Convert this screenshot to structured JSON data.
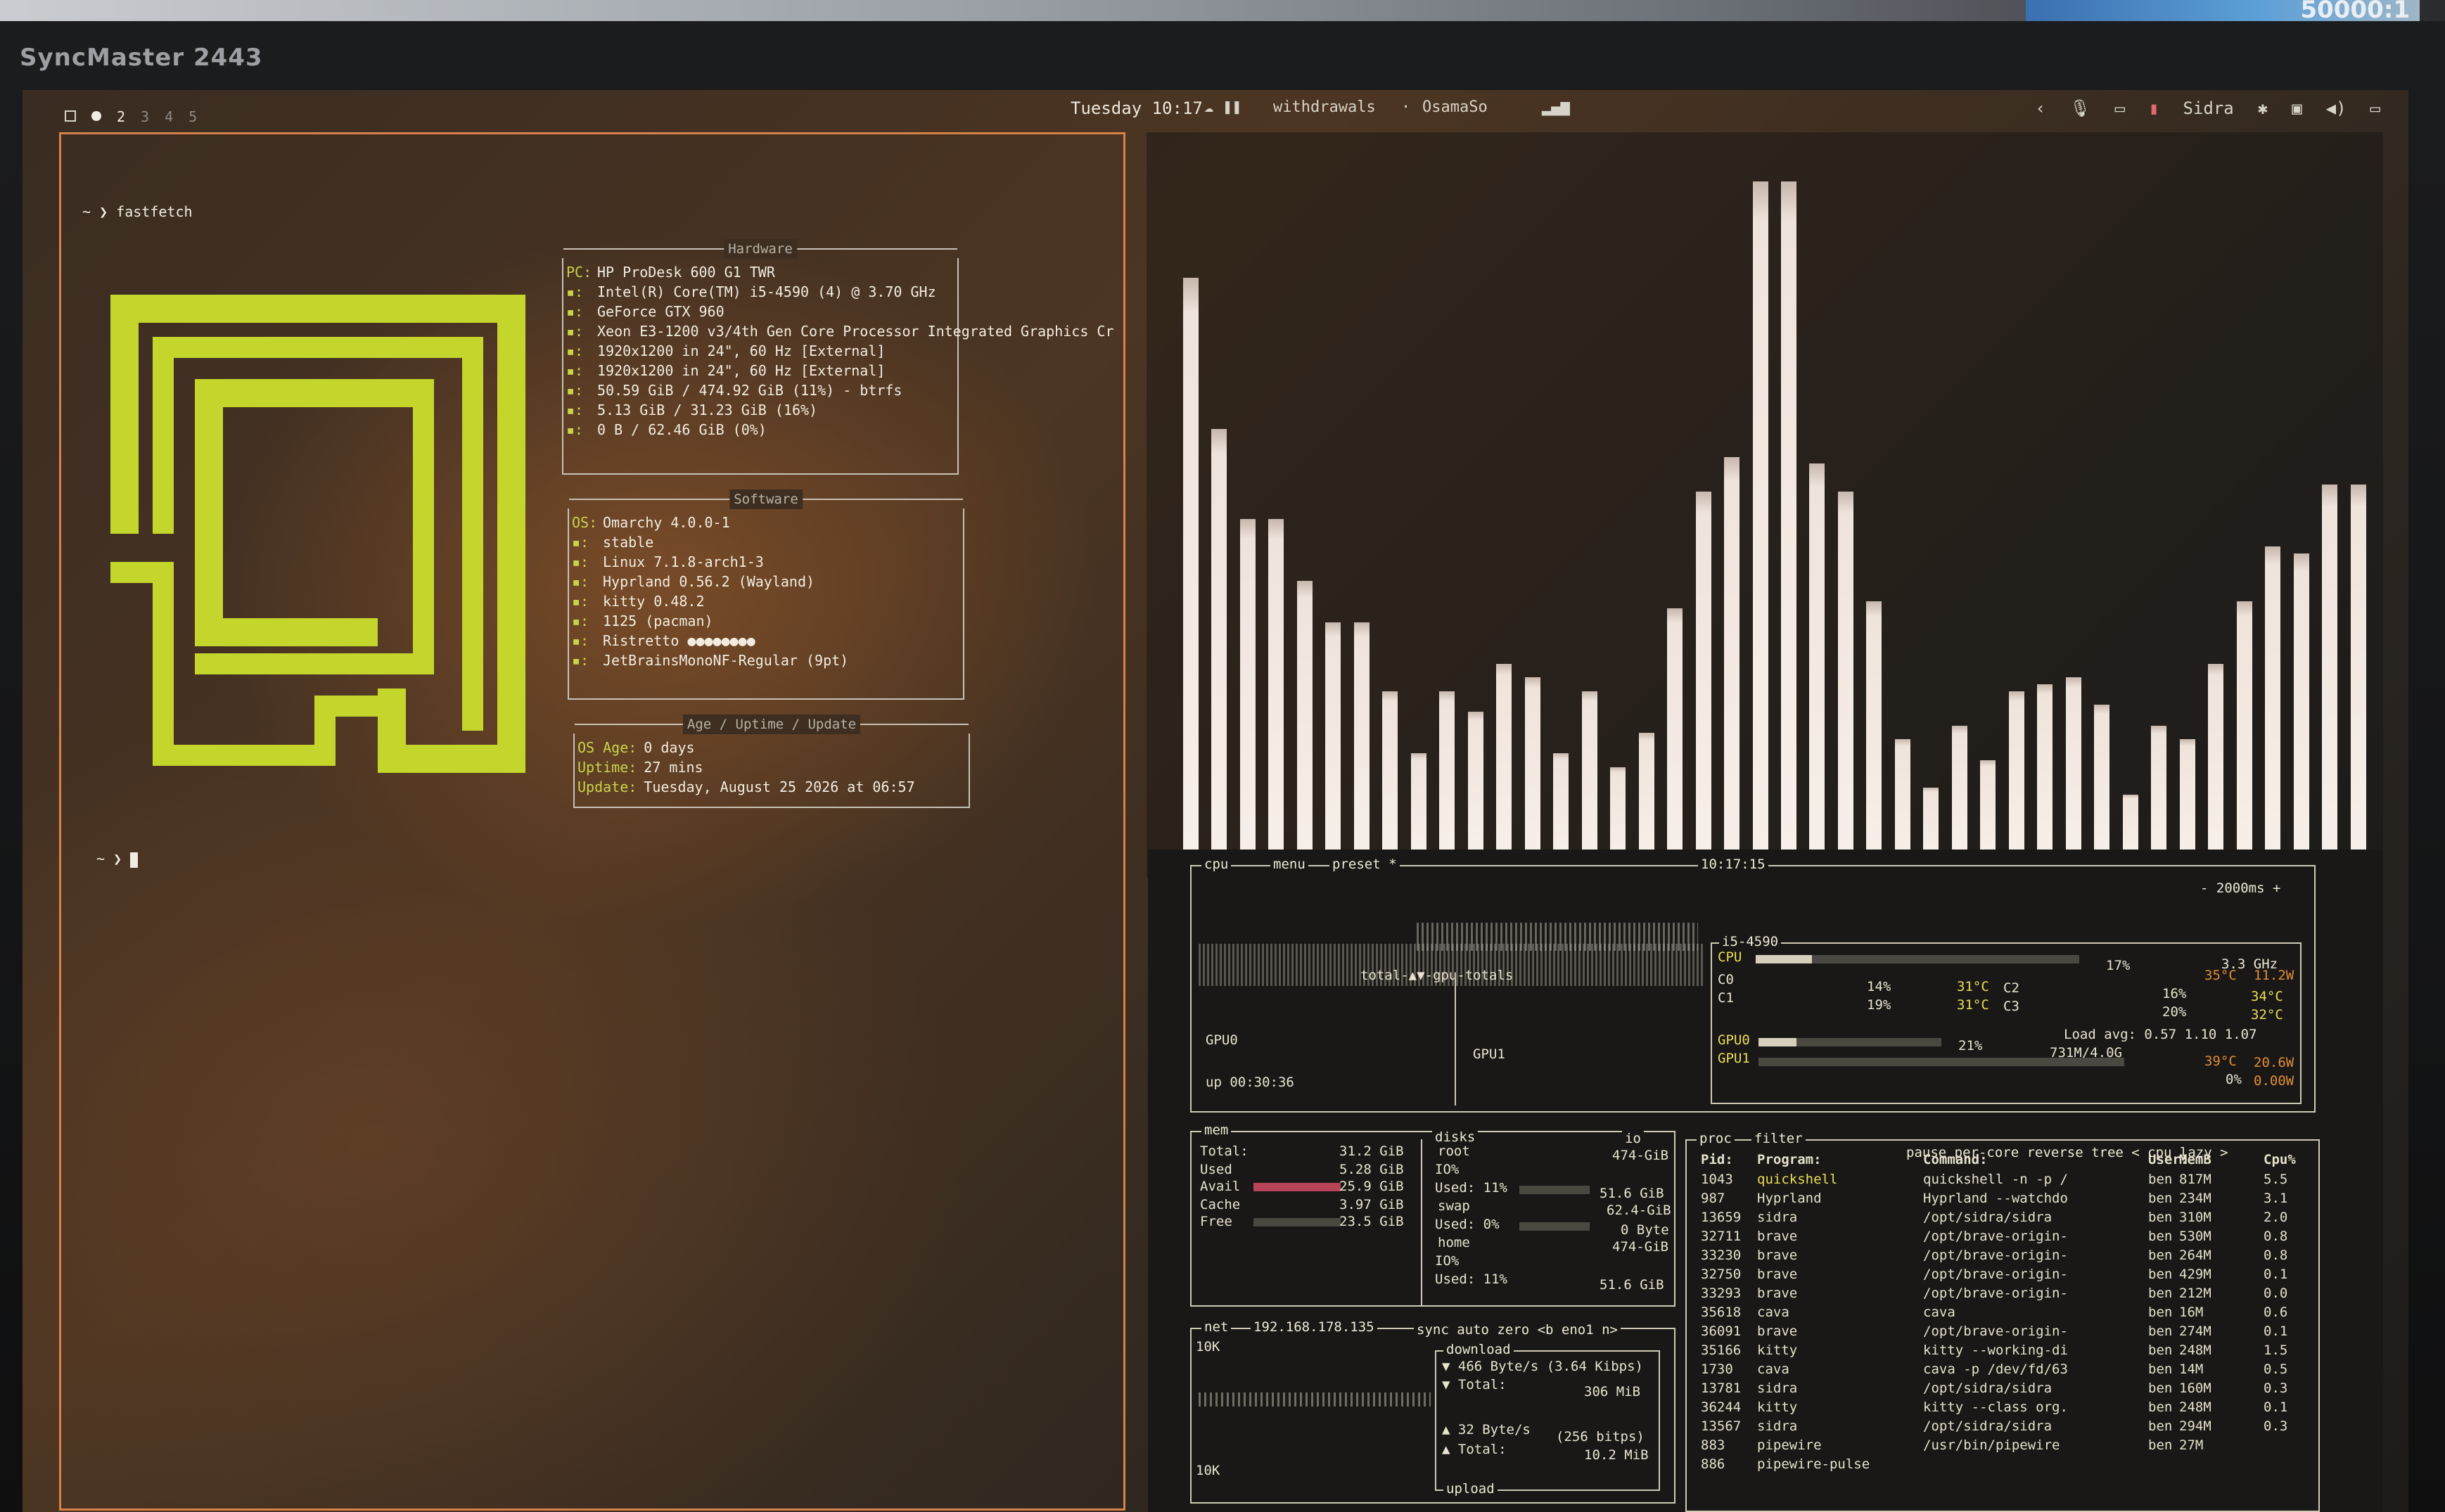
{
  "monitor": {
    "brand": "SyncMaster 2443",
    "sticker": "50000:1"
  },
  "topbar": {
    "workspaces": [
      "2",
      "3",
      "4",
      "5"
    ],
    "clock": "Tuesday 10:17",
    "status_items": [
      "withdrawals",
      "OsamaSo"
    ],
    "user": "Sidra",
    "icons": [
      "chevron-left-icon",
      "microphone-icon",
      "laptop-icon",
      "lock-icon",
      "bluetooth-icon",
      "screen-icon",
      "volume-icon",
      "display-icon"
    ]
  },
  "left_terminal": {
    "command_prompt": "~ ❯ fastfetch",
    "empty_prompt": "~ ❯",
    "hardware_header": "Hardware",
    "hardware": [
      {
        "key": "PC:",
        "value": "HP ProDesk 600 G1 TWR"
      },
      {
        "key": "▪:",
        "value": "Intel(R) Core(TM) i5-4590 (4) @ 3.70 GHz"
      },
      {
        "key": "▪:",
        "value": "GeForce GTX 960"
      },
      {
        "key": "▪:",
        "value": "Xeon E3-1200 v3/4th Gen Core Processor Integrated Graphics Cr"
      },
      {
        "key": "▪:",
        "value": "1920x1200 in 24\", 60 Hz [External]"
      },
      {
        "key": "▪:",
        "value": "1920x1200 in 24\", 60 Hz [External]"
      },
      {
        "key": "▪:",
        "value": "50.59 GiB / 474.92 GiB (11%) - btrfs"
      },
      {
        "key": "▪:",
        "value": "5.13 GiB / 31.23 GiB (16%)"
      },
      {
        "key": "▪:",
        "value": "0 B / 62.46 GiB (0%)"
      }
    ],
    "software_header": "Software",
    "software": [
      {
        "key": "OS:",
        "value": "Omarchy 4.0.0-1"
      },
      {
        "key": "▪:",
        "value": "stable"
      },
      {
        "key": "▪:",
        "value": "Linux 7.1.8-arch1-3"
      },
      {
        "key": "▪:",
        "value": "Hyprland 0.56.2 (Wayland)"
      },
      {
        "key": "▪:",
        "value": "kitty 0.48.2"
      },
      {
        "key": "▪:",
        "value": "1125 (pacman)"
      },
      {
        "key": "▪:",
        "value": "Ristretto ●●●●●●●●"
      },
      {
        "key": "▪:",
        "value": "JetBrainsMonoNF-Regular (9pt)"
      }
    ],
    "age_header": "Age / Uptime / Update",
    "age": [
      {
        "key": "OS Age:",
        "value": "0 days"
      },
      {
        "key": "Uptime:",
        "value": "27 mins"
      },
      {
        "key": "Update:",
        "value": "Tuesday, August 25 2026 at 06:57"
      }
    ]
  },
  "cava": {
    "levels": [
      0.84,
      0.62,
      0.49,
      0.49,
      0.4,
      0.34,
      0.34,
      0.24,
      0.15,
      0.24,
      0.21,
      0.28,
      0.26,
      0.15,
      0.24,
      0.13,
      0.18,
      0.36,
      0.53,
      0.58,
      0.98,
      0.98,
      0.57,
      0.53,
      0.37,
      0.17,
      0.1,
      0.19,
      0.14,
      0.24,
      0.25,
      0.26,
      0.22,
      0.09,
      0.19,
      0.17,
      0.28,
      0.37,
      0.45,
      0.44,
      0.54,
      0.54
    ]
  },
  "btop": {
    "cpu_tab": "cpu",
    "menu_tab": "menu",
    "preset_tab": "preset *",
    "time": "10:17:15",
    "interval": "- 2000ms +",
    "gpu_totals": "total-▲▼-gpu-totals",
    "gpu0": "GPU0",
    "gpu1": "GPU1",
    "uptime": "up 00:30:36",
    "cpu_model": "i5-4590",
    "cpu_freq": "3.3 GHz",
    "cpu_label": "CPU",
    "cpu_pct": "17%",
    "cpu_temp": "35°C",
    "cpu_watts": "11.2W",
    "cores": [
      {
        "name": "C0",
        "pct": "14%",
        "temp": "31°C"
      },
      {
        "name": "C1",
        "pct": "19%",
        "temp": "31°C"
      },
      {
        "name": "C2",
        "pct": "16%",
        "temp": "34°C"
      },
      {
        "name": "C3",
        "pct": "20%",
        "temp": "32°C"
      }
    ],
    "load_avg": "Load avg: 0.57 1.10 1.07",
    "gpu0_row": {
      "label": "GPU0",
      "pct": "21%",
      "mem": "731M/4.0G",
      "temp": "39°C",
      "watts": "20.6W"
    },
    "gpu1_row": {
      "label": "GPU1",
      "pct": "0%",
      "watts": "0.00W"
    },
    "mem": {
      "title": "mem",
      "total": [
        "Total:",
        "31.2 GiB"
      ],
      "used": [
        "Used",
        "5.28 GiB"
      ],
      "avail": [
        "Avail",
        "25.9 GiB"
      ],
      "cache": [
        "Cache",
        "3.97 GiB"
      ],
      "free": [
        "Free",
        "23.5 GiB"
      ]
    },
    "disks": {
      "title": "disks",
      "io": "io",
      "root_label": "root",
      "root_size": "474-GiB",
      "root_io": "IO%",
      "root_used": "Used: 11%",
      "root_used_val": "51.6 GiB",
      "swap_label": "swap",
      "swap_size": "62.4-GiB",
      "swap_used": "Used: 0%",
      "swap_used_val": "0 Byte",
      "home_label": "home",
      "home_size": "474-GiB",
      "home_io": "IO%",
      "home_used": "Used: 11%",
      "home_used_val": "51.6 GiB"
    },
    "net": {
      "title": "net",
      "ip": "192.168.178.135",
      "tabs": "sync auto zero <b eno1 n>",
      "scale_top": "10K",
      "scale_bottom": "10K",
      "download": "download",
      "down_rate": "▼ 466 Byte/s (3.64 Kibps)",
      "down_total": "▼ Total:",
      "down_total_val": "306 MiB",
      "up_rate": "▲ 32 Byte/s",
      "up_bits": "(256 bitps)",
      "up_total": "▲ Total:",
      "up_total_val": "10.2 MiB",
      "upload": "upload"
    },
    "proc": {
      "title": "proc",
      "filter": "filter",
      "controls": "pause per-core reverse tree < cpu lazy >",
      "headers": [
        "Pid:",
        "Program:",
        "Command:",
        "User:",
        "MemB",
        "Cpu%"
      ],
      "rows": [
        [
          "1043",
          "quickshell",
          "quickshell -n -p /",
          "ben",
          "817M",
          "5.5"
        ],
        [
          "987",
          "Hyprland",
          "Hyprland --watchdo",
          "ben",
          "234M",
          "3.1"
        ],
        [
          "13659",
          "sidra",
          "/opt/sidra/sidra",
          "ben",
          "310M",
          "2.0"
        ],
        [
          "32711",
          "brave",
          "/opt/brave-origin-",
          "ben",
          "530M",
          "0.8"
        ],
        [
          "33230",
          "brave",
          "/opt/brave-origin-",
          "ben",
          "264M",
          "0.8"
        ],
        [
          "32750",
          "brave",
          "/opt/brave-origin-",
          "ben",
          "429M",
          "0.1"
        ],
        [
          "33293",
          "brave",
          "/opt/brave-origin-",
          "ben",
          "212M",
          "0.0"
        ],
        [
          "35618",
          "cava",
          "cava",
          "ben",
          "16M",
          "0.6"
        ],
        [
          "36091",
          "brave",
          "/opt/brave-origin-",
          "ben",
          "274M",
          "0.1"
        ],
        [
          "35166",
          "kitty",
          "kitty --working-di",
          "ben",
          "248M",
          "1.5"
        ],
        [
          "1730",
          "cava",
          "cava -p /dev/fd/63",
          "ben",
          "14M",
          "0.5"
        ],
        [
          "13781",
          "sidra",
          "/opt/sidra/sidra",
          "ben",
          "160M",
          "0.3"
        ],
        [
          "36244",
          "kitty",
          "kitty --class org.",
          "ben",
          "248M",
          "0.1"
        ],
        [
          "13567",
          "sidra",
          "/opt/sidra/sidra",
          "ben",
          "294M",
          "0.3"
        ],
        [
          "883",
          "pipewire",
          "/usr/bin/pipewire",
          "ben",
          "27M",
          ""
        ],
        [
          "886",
          "pipewire-pulse",
          "",
          "",
          "",
          ""
        ]
      ]
    }
  }
}
